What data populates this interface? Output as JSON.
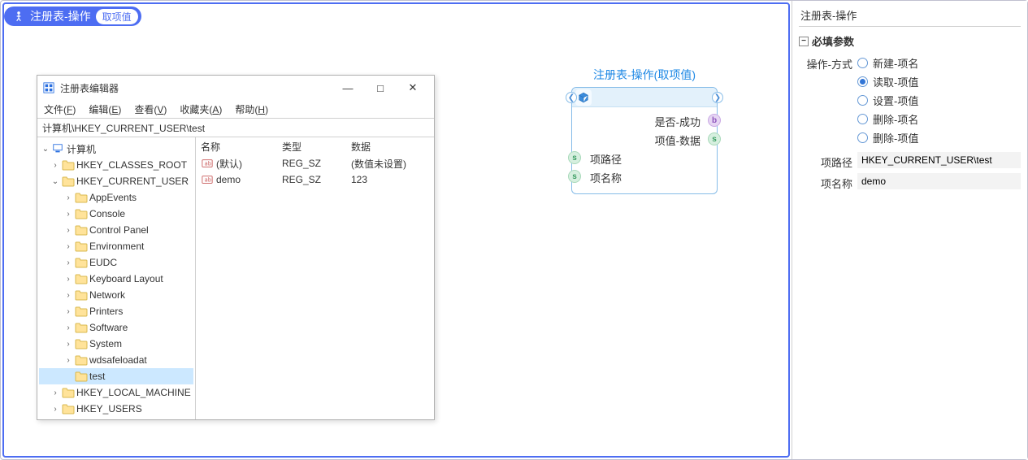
{
  "header": {
    "title": "注册表-操作",
    "chip": "取项值"
  },
  "regwin": {
    "title": "注册表编辑器",
    "menus": [
      {
        "label": "文件",
        "hotkey": "F"
      },
      {
        "label": "编辑",
        "hotkey": "E"
      },
      {
        "label": "查看",
        "hotkey": "V"
      },
      {
        "label": "收藏夹",
        "hotkey": "A"
      },
      {
        "label": "帮助",
        "hotkey": "H"
      }
    ],
    "address": "计算机\\HKEY_CURRENT_USER\\test",
    "tree_root": "计算机",
    "tree": {
      "hives": [
        {
          "name": "HKEY_CLASSES_ROOT",
          "expandable": true
        },
        {
          "name": "HKEY_CURRENT_USER",
          "expanded": true,
          "children": [
            "AppEvents",
            "Console",
            "Control Panel",
            "Environment",
            "EUDC",
            "Keyboard Layout",
            "Network",
            "Printers",
            "Software",
            "System",
            "wdsafeloadat",
            "test"
          ],
          "selected_child": "test"
        },
        {
          "name": "HKEY_LOCAL_MACHINE",
          "expandable": true
        },
        {
          "name": "HKEY_USERS",
          "expandable": true
        }
      ]
    },
    "list": {
      "headers": {
        "name": "名称",
        "type": "类型",
        "data": "数据"
      },
      "rows": [
        {
          "name": "(默认)",
          "type": "REG_SZ",
          "data": "(数值未设置)"
        },
        {
          "name": "demo",
          "type": "REG_SZ",
          "data": "123"
        }
      ]
    }
  },
  "flow": {
    "title": "注册表-操作(取项值)",
    "outputs": [
      {
        "label": "是否-成功",
        "port": "b"
      },
      {
        "label": "项值-数据",
        "port": "s"
      }
    ],
    "inputs": [
      {
        "label": "项路径",
        "port": "s"
      },
      {
        "label": "项名称",
        "port": "s"
      }
    ]
  },
  "props": {
    "panel_title": "注册表-操作",
    "section_required": "必填参数",
    "mode_label": "操作-方式",
    "modes": [
      {
        "label": "新建-项名",
        "checked": false
      },
      {
        "label": "读取-项值",
        "checked": true
      },
      {
        "label": "设置-项值",
        "checked": false
      },
      {
        "label": "删除-项名",
        "checked": false
      },
      {
        "label": "删除-项值",
        "checked": false
      }
    ],
    "path_label": "项路径",
    "path_value": "HKEY_CURRENT_USER\\test",
    "name_label": "项名称",
    "name_value": "demo"
  }
}
